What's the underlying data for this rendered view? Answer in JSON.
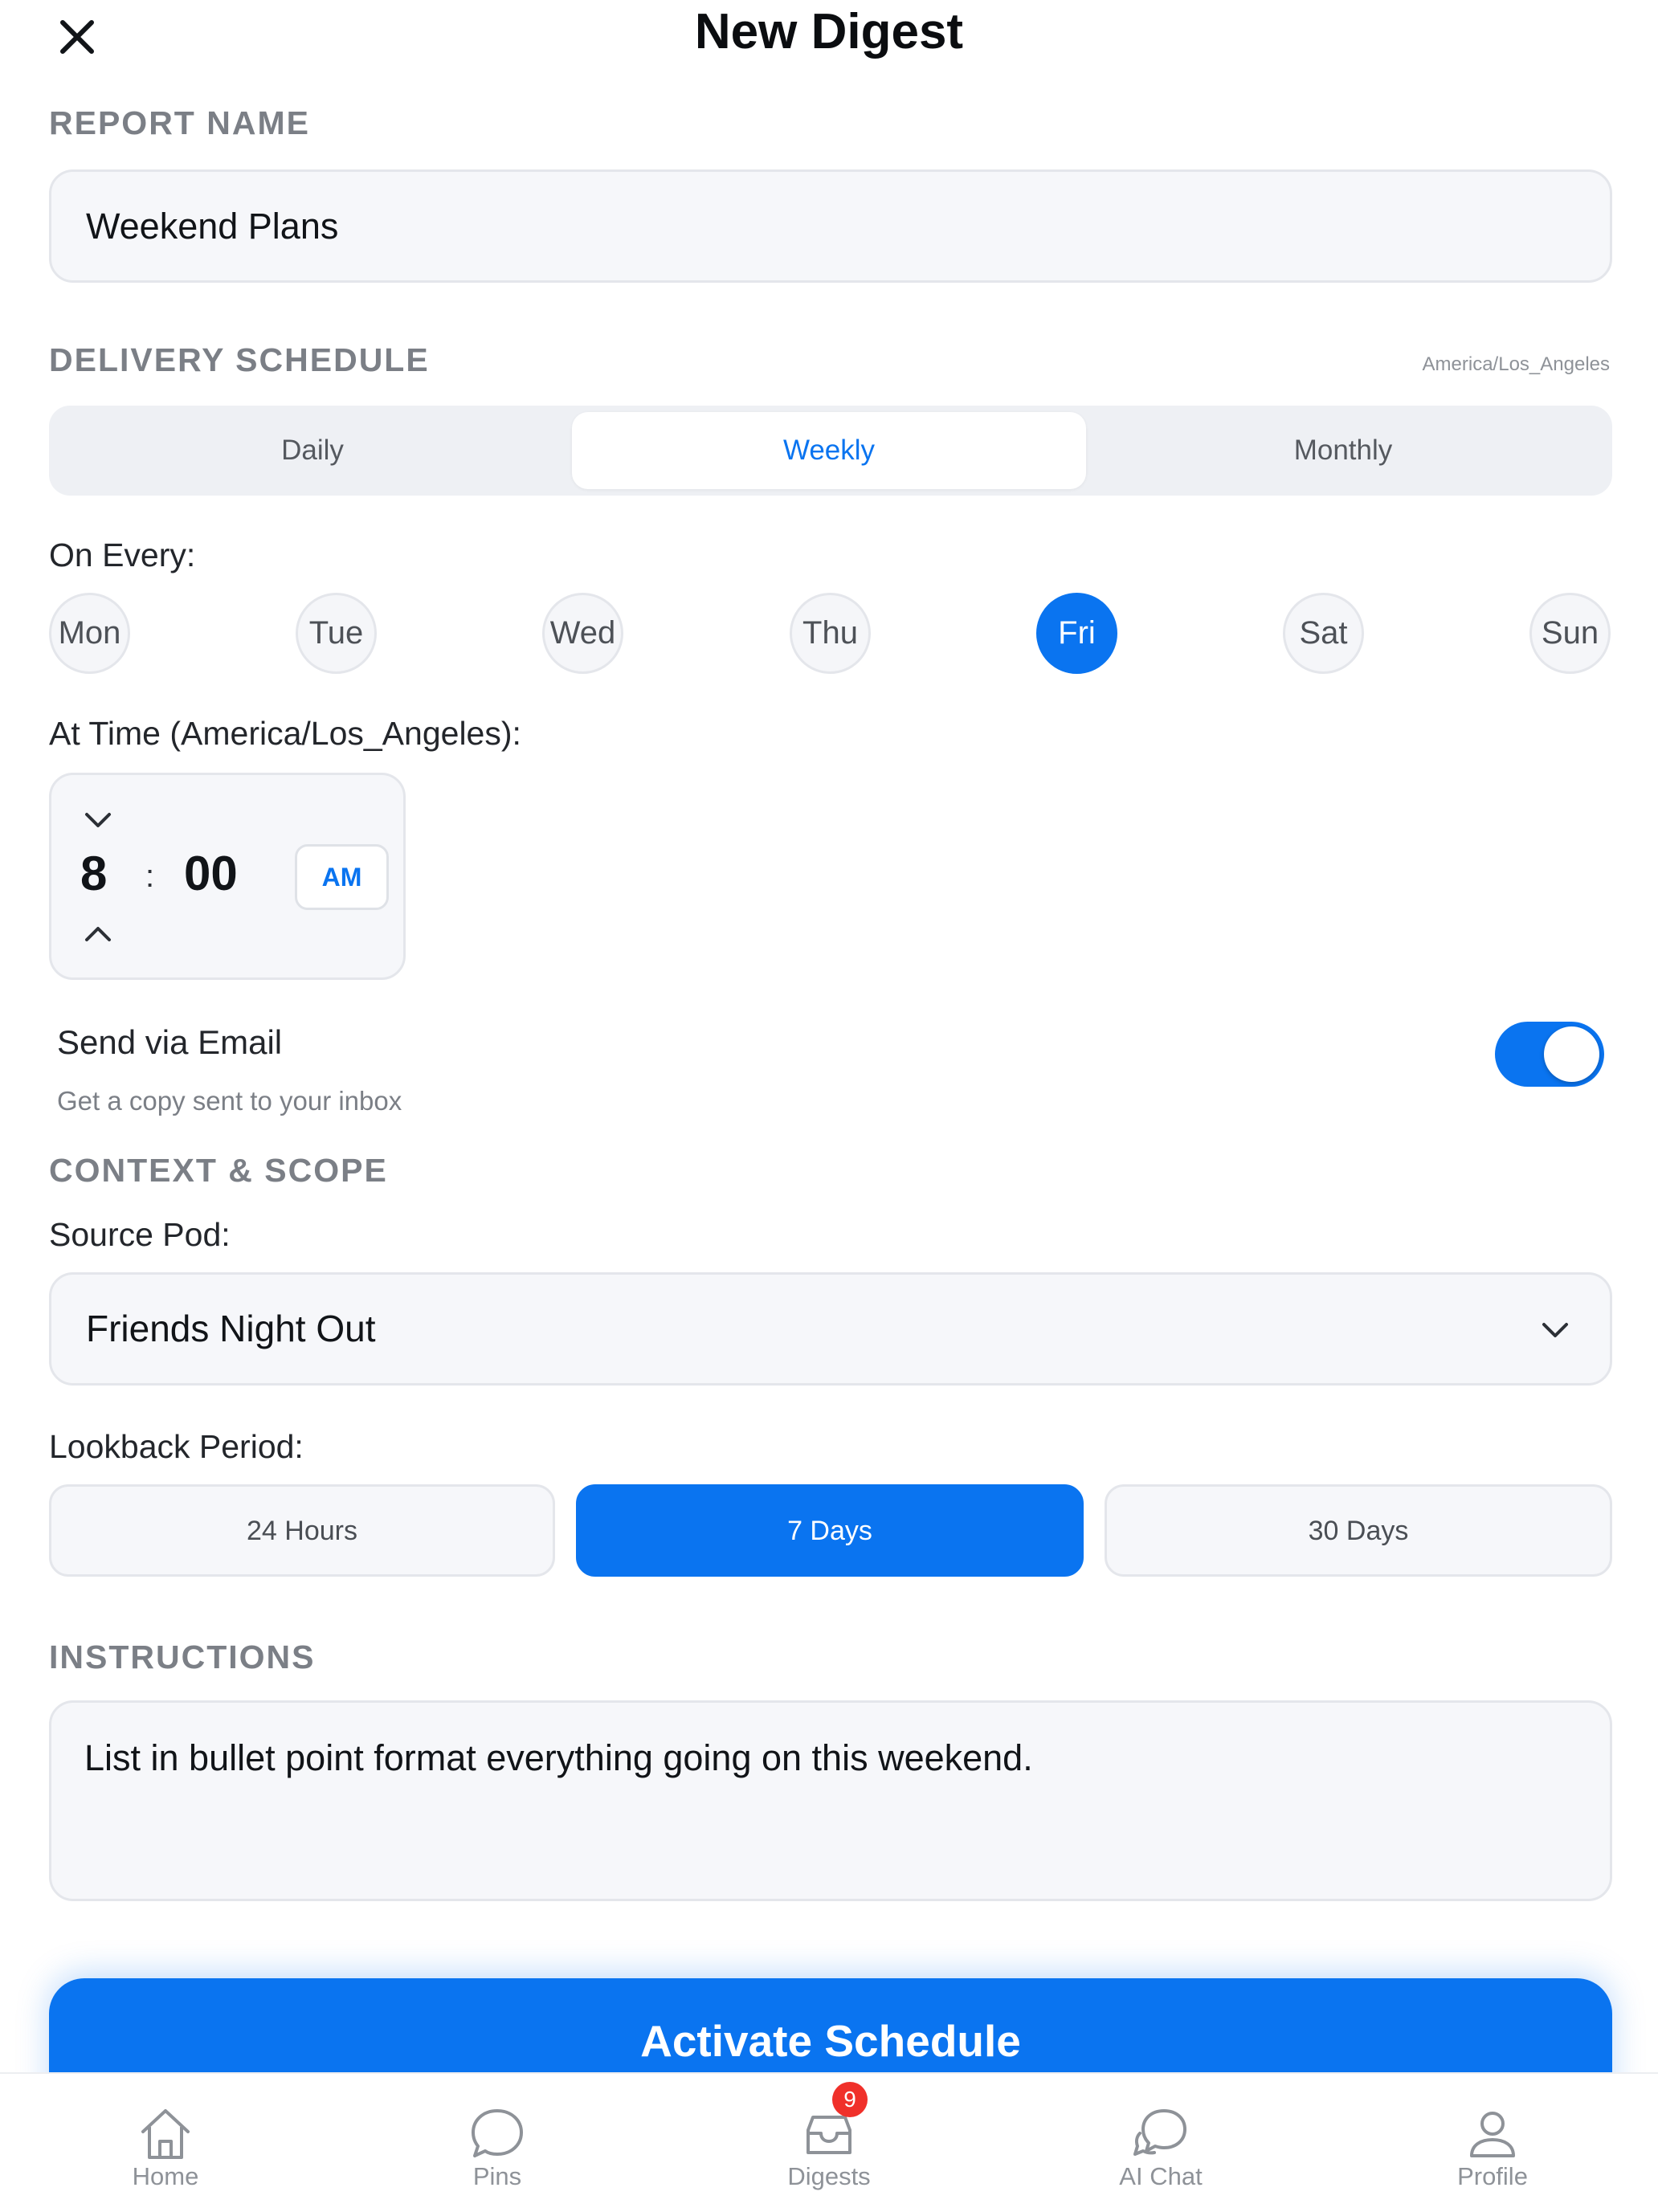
{
  "header": {
    "title": "New Digest"
  },
  "report_name": {
    "label": "REPORT NAME",
    "value": "Weekend Plans"
  },
  "delivery": {
    "label": "DELIVERY SCHEDULE",
    "timezone": "America/Los_Angeles",
    "frequency_options": [
      "Daily",
      "Weekly",
      "Monthly"
    ],
    "selected_frequency": "Weekly",
    "on_every_label": "On Every:",
    "days": [
      "Mon",
      "Tue",
      "Wed",
      "Thu",
      "Fri",
      "Sat",
      "Sun"
    ],
    "selected_day": "Fri",
    "time_label": "At Time (America/Los_Angeles):",
    "time": {
      "hour": "8",
      "separator": ":",
      "minute": "00",
      "period": "AM"
    }
  },
  "email": {
    "title": "Send via Email",
    "subtitle": "Get a copy sent to your inbox",
    "enabled": true
  },
  "context": {
    "label": "CONTEXT & SCOPE",
    "source_pod_label": "Source Pod:",
    "source_pod_value": "Friends Night Out",
    "lookback_label": "Lookback Period:",
    "lookback_options": [
      "24 Hours",
      "7 Days",
      "30 Days"
    ],
    "selected_lookback": "7 Days"
  },
  "instructions": {
    "label": "INSTRUCTIONS",
    "value": "List in bullet point format everything going on this weekend."
  },
  "activate_button": "Activate Schedule",
  "tabbar": {
    "items": [
      {
        "label": "Home",
        "icon": "home-icon"
      },
      {
        "label": "Pins",
        "icon": "chat-bubble-icon"
      },
      {
        "label": "Digests",
        "icon": "inbox-icon",
        "badge": "9"
      },
      {
        "label": "AI Chat",
        "icon": "ai-chat-icon"
      },
      {
        "label": "Profile",
        "icon": "person-icon"
      }
    ]
  },
  "colors": {
    "accent": "#0a74f0",
    "badge": "#f0302a",
    "muted": "#7b7f86"
  }
}
